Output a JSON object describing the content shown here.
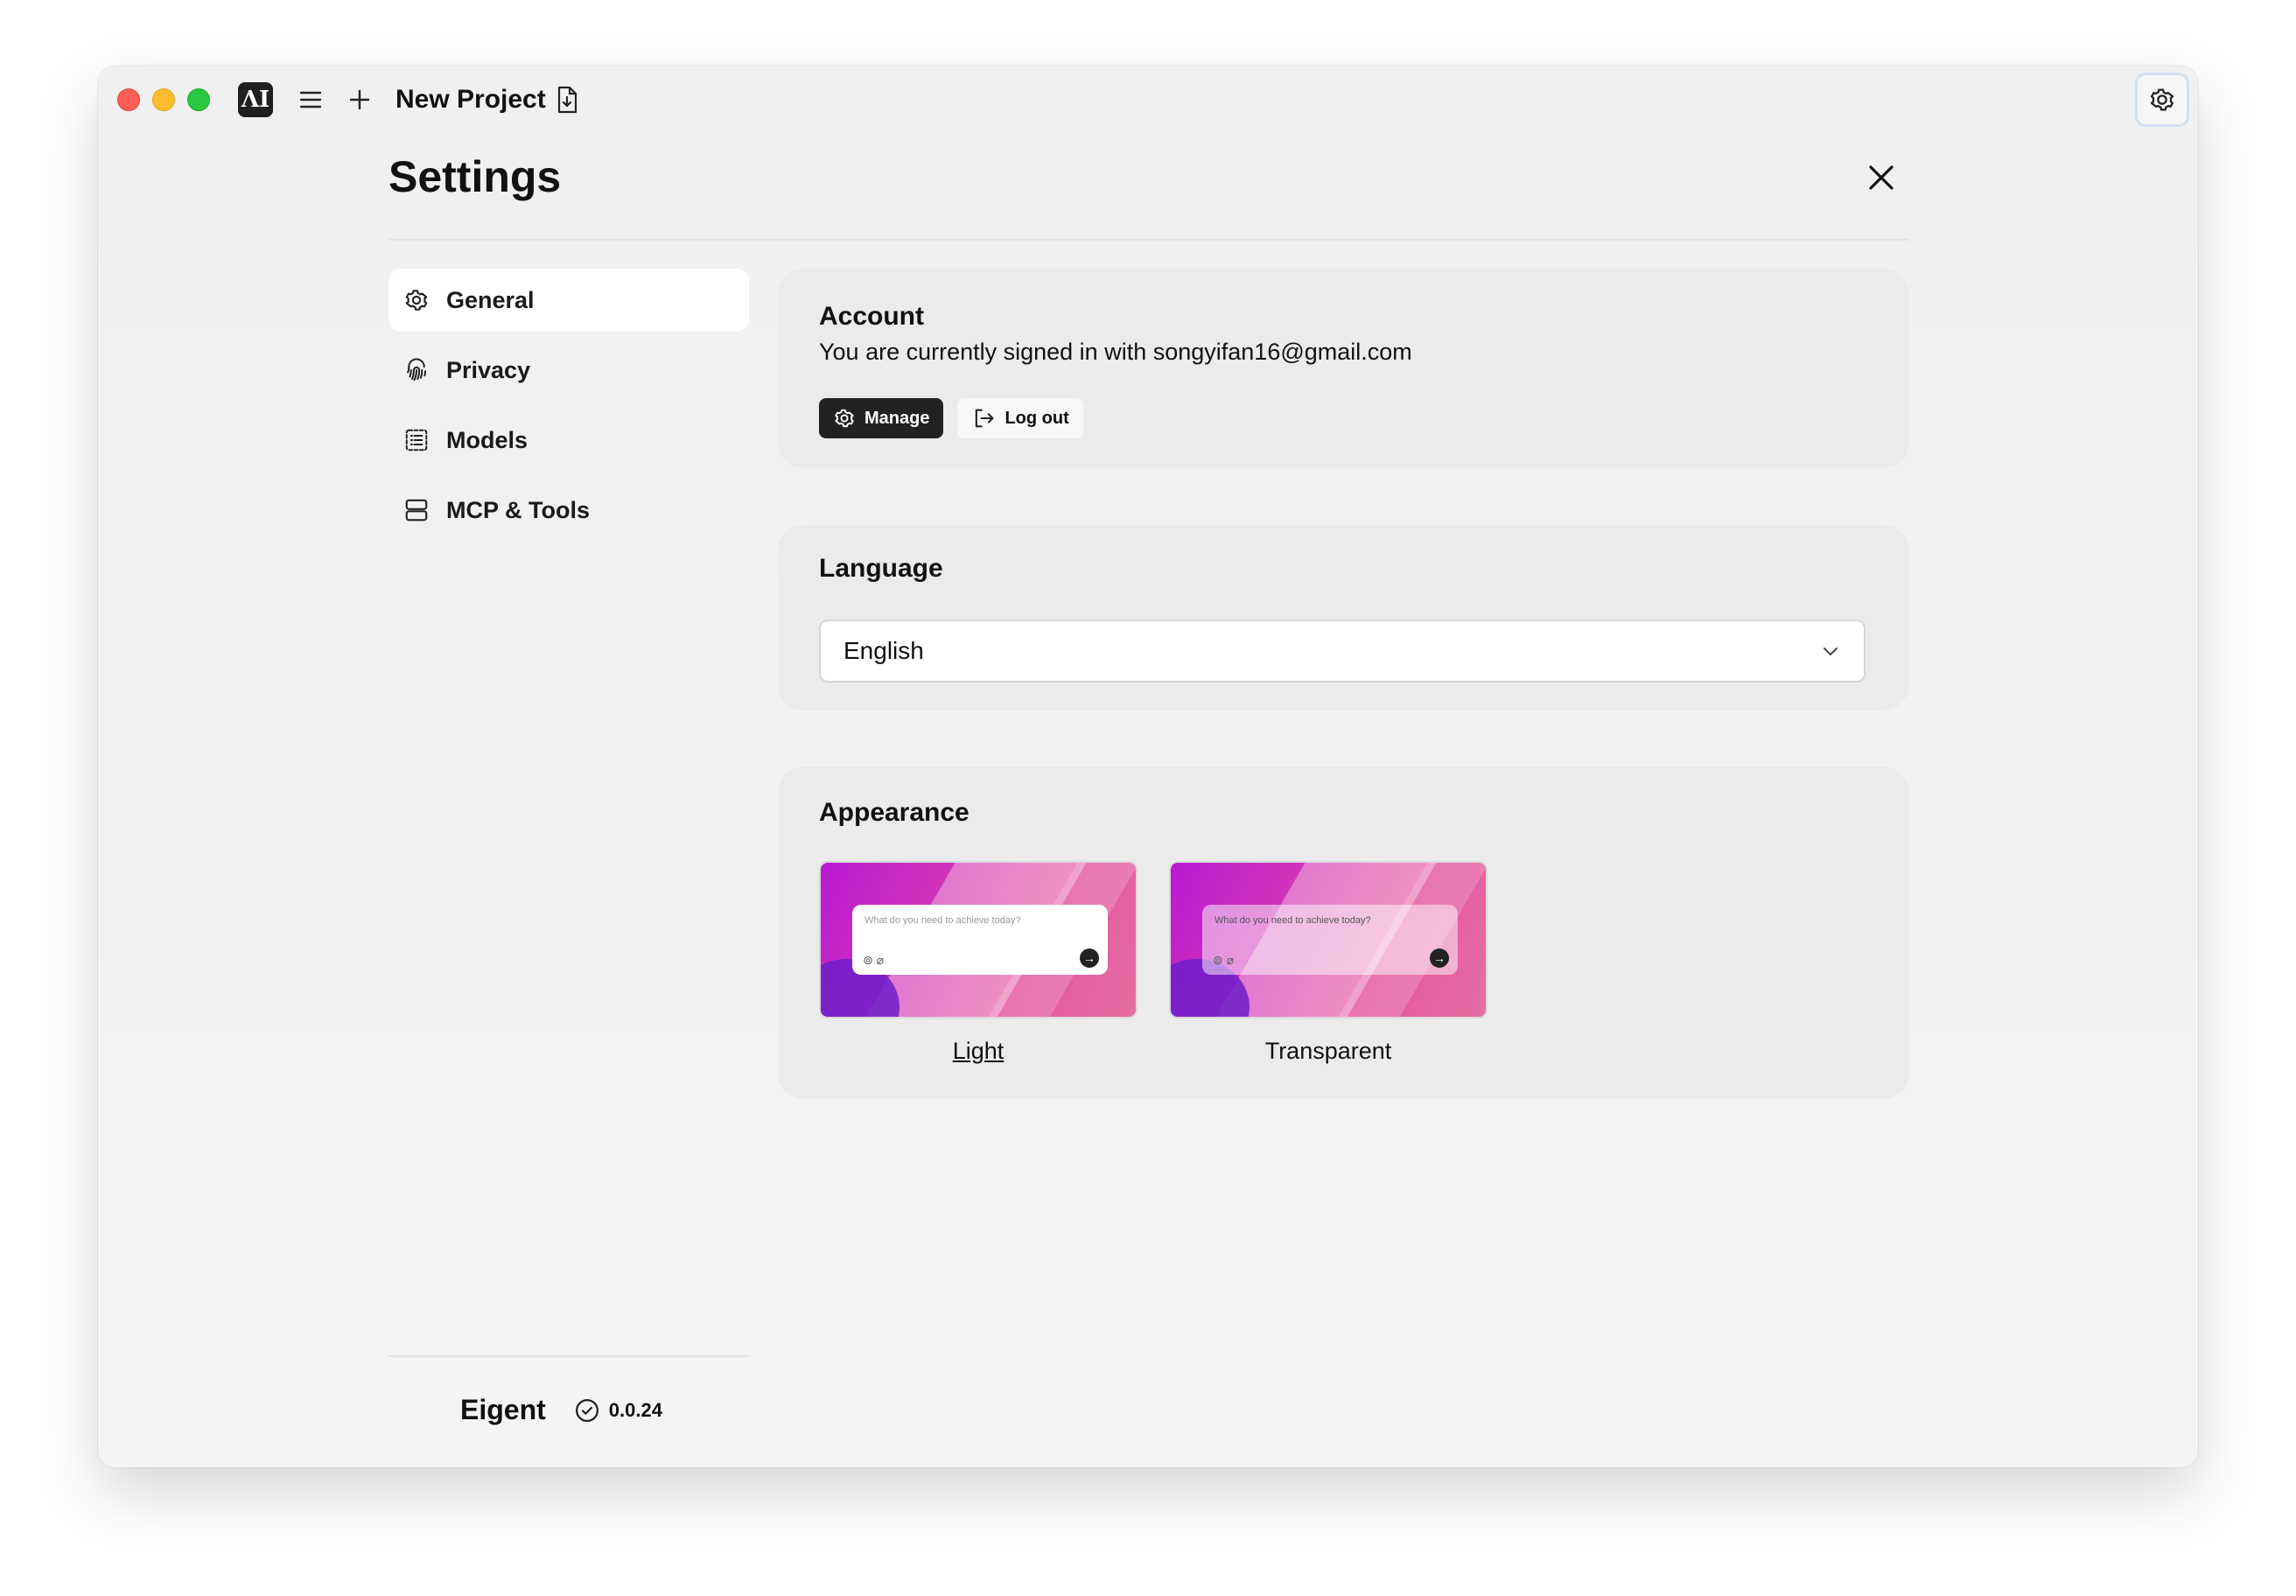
{
  "titlebar": {
    "project_title": "New Project",
    "app_logo_text": "ΛI"
  },
  "page": {
    "title": "Settings"
  },
  "sidebar": {
    "items": [
      {
        "label": "General",
        "icon": "gear-icon",
        "active": true
      },
      {
        "label": "Privacy",
        "icon": "fingerprint-icon",
        "active": false
      },
      {
        "label": "Models",
        "icon": "list-icon",
        "active": false
      },
      {
        "label": "MCP & Tools",
        "icon": "server-icon",
        "active": false
      }
    ],
    "footer": {
      "brand": "Eigent",
      "version": "0.0.24"
    }
  },
  "account": {
    "title": "Account",
    "subtitle": "You are currently signed in with songyifan16@gmail.com",
    "manage_label": "Manage",
    "logout_label": "Log out"
  },
  "language": {
    "title": "Language",
    "selected": "English"
  },
  "appearance": {
    "title": "Appearance",
    "options": [
      {
        "label": "Light",
        "selected": true,
        "preview_placeholder": "What do you need to achieve today?"
      },
      {
        "label": "Transparent",
        "selected": false,
        "preview_placeholder": "What do you need to achieve today?"
      }
    ]
  },
  "colors": {
    "window_bg": "#f0f0f0",
    "card_bg": "#ebebeb",
    "dark_button": "#222222",
    "traffic_red": "#ff5f57",
    "traffic_yellow": "#febc2e",
    "traffic_green": "#28c840"
  }
}
